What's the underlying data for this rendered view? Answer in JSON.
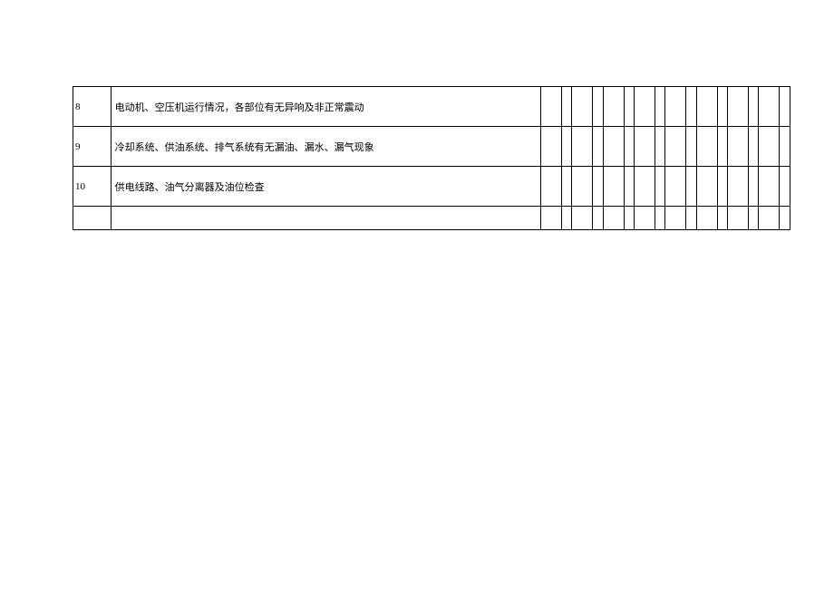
{
  "rows": [
    {
      "num": "8",
      "desc": "电动机、空压机运行情况，各部位有无异响及非正常震动"
    },
    {
      "num": "9",
      "desc": "冷却系统、供油系统、排气系统有无漏油、漏水、漏气现象"
    },
    {
      "num": "10",
      "desc": "供电线路、油气分离器及油位检查"
    },
    {
      "num": "",
      "desc": ""
    }
  ]
}
